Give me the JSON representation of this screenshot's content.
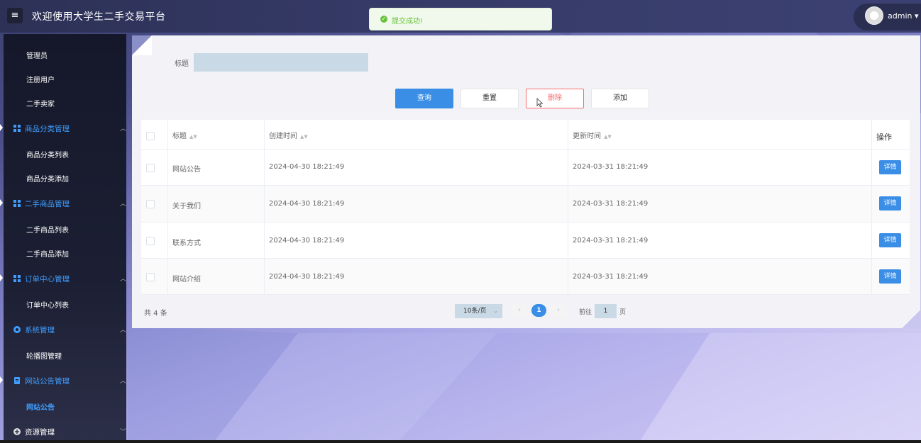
{
  "header": {
    "menu_icon": "hamburger-icon",
    "title": "欢迎使用大学生二手交易平台",
    "username": "admin"
  },
  "toast": {
    "icon": "check-circle-icon",
    "message": "提交成功!"
  },
  "sidebar": {
    "items": [
      {
        "type": "sub",
        "label": "管理员"
      },
      {
        "type": "sub",
        "label": "注册用户"
      },
      {
        "type": "sub",
        "label": "二手卖家"
      },
      {
        "type": "group",
        "label": "商品分类管理",
        "icon": "grid-icon"
      },
      {
        "type": "sub",
        "label": "商品分类列表"
      },
      {
        "type": "sub",
        "label": "商品分类添加"
      },
      {
        "type": "group",
        "label": "二手商品管理",
        "icon": "grid-icon"
      },
      {
        "type": "sub",
        "label": "二手商品列表"
      },
      {
        "type": "sub",
        "label": "二手商品添加"
      },
      {
        "type": "group",
        "label": "订单中心管理",
        "icon": "grid-icon"
      },
      {
        "type": "sub",
        "label": "订单中心列表"
      },
      {
        "type": "group",
        "label": "系统管理",
        "icon": "gear-icon"
      },
      {
        "type": "sub",
        "label": "轮播图管理"
      },
      {
        "type": "group",
        "label": "网站公告管理",
        "icon": "document-icon"
      },
      {
        "type": "sub",
        "label": "网站公告",
        "active": true
      },
      {
        "type": "group",
        "label": "资源管理",
        "icon": "plus-circle-icon"
      }
    ]
  },
  "search": {
    "title_label": "标题",
    "title_value": ""
  },
  "buttons": {
    "query": "查询",
    "reset": "重置",
    "delete": "删除",
    "add": "添加"
  },
  "table": {
    "headers": {
      "title": "标题",
      "created": "创建时间",
      "updated": "更新时间",
      "actions": "操作"
    },
    "detail_label": "详情",
    "rows": [
      {
        "title": "网站公告",
        "created": "2024-04-30 18:21:49",
        "updated": "2024-03-31 18:21:49"
      },
      {
        "title": "关于我们",
        "created": "2024-04-30 18:21:49",
        "updated": "2024-03-31 18:21:49"
      },
      {
        "title": "联系方式",
        "created": "2024-04-30 18:21:49",
        "updated": "2024-03-31 18:21:49"
      },
      {
        "title": "网站介绍",
        "created": "2024-04-30 18:21:49",
        "updated": "2024-03-31 18:21:49"
      }
    ]
  },
  "pagination": {
    "total": "共 4 条",
    "page_size": "10条/页",
    "current_page": "1",
    "goto_label": "前往",
    "goto_value": "1",
    "goto_suffix": "页",
    "prev_icon": "chevron-left-icon",
    "next_icon": "chevron-right-icon"
  },
  "colors": {
    "primary": "#3a8ee6",
    "danger": "#f56c6c",
    "success": "#67c23a",
    "sidebar_group": "#409eff"
  }
}
